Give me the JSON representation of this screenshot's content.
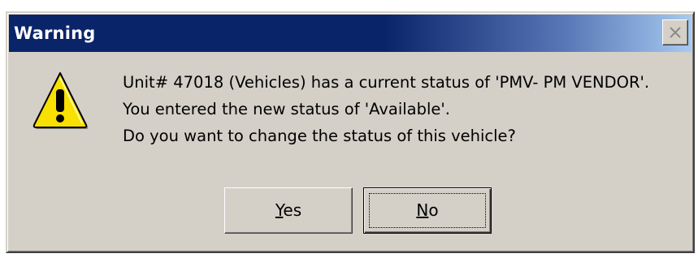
{
  "window": {
    "title": "Warning",
    "close_label": "×"
  },
  "icon": {
    "name": "warning-icon",
    "glyph": "!"
  },
  "message": {
    "line1": "Unit# 47018 (Vehicles) has a current status of 'PMV- PM VENDOR'.",
    "line2": "You entered the new status of 'Available'.",
    "line3": "Do you want to change the status of this vehicle?"
  },
  "buttons": {
    "yes": {
      "mnemonic": "Y",
      "rest": "es"
    },
    "no": {
      "mnemonic": "N",
      "rest": "o"
    }
  },
  "colors": {
    "title_bar_start": "#0a246a",
    "title_bar_end": "#a6caf0",
    "dialog_face": "#d4d0c8",
    "warning_yellow": "#f8e000"
  }
}
